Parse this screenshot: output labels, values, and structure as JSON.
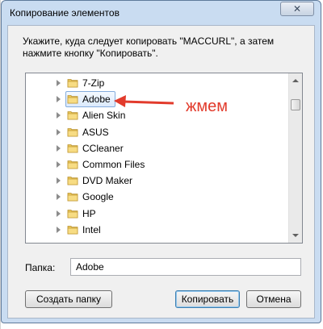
{
  "window": {
    "title": "Копирование элементов",
    "close_glyph": "✕"
  },
  "instruction": "Укажите, куда следует копировать \"MACCURL\", а затем нажмите кнопку \"Копировать\".",
  "tree": {
    "items": [
      {
        "label": "7-Zip",
        "selected": false
      },
      {
        "label": "Adobe",
        "selected": true
      },
      {
        "label": "Alien Skin",
        "selected": false
      },
      {
        "label": "ASUS",
        "selected": false
      },
      {
        "label": "CCleaner",
        "selected": false
      },
      {
        "label": "Common Files",
        "selected": false
      },
      {
        "label": "DVD Maker",
        "selected": false
      },
      {
        "label": "Google",
        "selected": false
      },
      {
        "label": "HP",
        "selected": false
      },
      {
        "label": "Intel",
        "selected": false
      }
    ],
    "icons": {
      "expand": "chevron-right-icon",
      "folder": "folder-icon"
    }
  },
  "annotation": {
    "text": "жмем",
    "color": "#e23b2c"
  },
  "folder_field": {
    "label": "Папка:",
    "value": "Adobe"
  },
  "buttons": {
    "new_folder": "Создать папку",
    "copy": "Копировать",
    "cancel": "Отмена"
  }
}
